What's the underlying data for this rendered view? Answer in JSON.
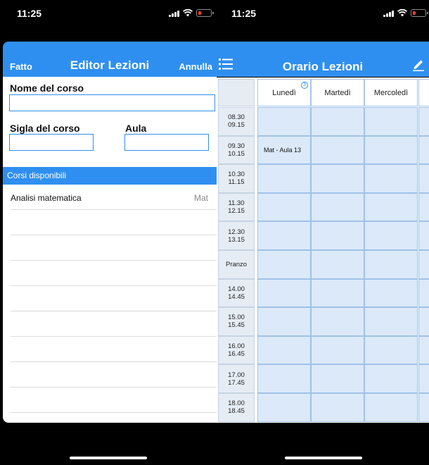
{
  "status": {
    "time": "11:25"
  },
  "editor": {
    "done_label": "Fatto",
    "title": "Editor Lezioni",
    "cancel_label": "Annulla",
    "course_name_label": "Nome del corso",
    "course_name_value": "",
    "course_code_label": "Sigla del corso",
    "course_code_value": "",
    "room_label": "Aula",
    "room_value": "",
    "section_title": "Corsi disponibili",
    "courses": [
      {
        "name": "Analisi matematica",
        "code": "Mat"
      },
      {
        "name": "",
        "code": ""
      },
      {
        "name": "",
        "code": ""
      },
      {
        "name": "",
        "code": ""
      },
      {
        "name": "",
        "code": ""
      },
      {
        "name": "",
        "code": ""
      },
      {
        "name": "",
        "code": ""
      },
      {
        "name": "",
        "code": ""
      },
      {
        "name": "",
        "code": ""
      }
    ]
  },
  "timetable": {
    "title": "Orario Lezioni",
    "menu_icon": "list-icon",
    "edit_icon": "pencil-icon",
    "days": [
      {
        "label": "Lunedì",
        "badge": "3"
      },
      {
        "label": "Martedì",
        "badge": ""
      },
      {
        "label": "Mercoledì",
        "badge": ""
      },
      {
        "label": "",
        "badge": ""
      }
    ],
    "slots": [
      "08.30\n09.15",
      "09.30\n10.15",
      "10.30\n11.15",
      "11.30\n12.15",
      "12.30\n13.15",
      "Pranzo",
      "14.00\n14.45",
      "15.00\n15.45",
      "16.00\n16.45",
      "17.00\n17.45",
      "18.00\n18.45"
    ],
    "entries": [
      {
        "slot": 1,
        "day": 0,
        "text": "Mat - Aula 13"
      }
    ]
  }
}
